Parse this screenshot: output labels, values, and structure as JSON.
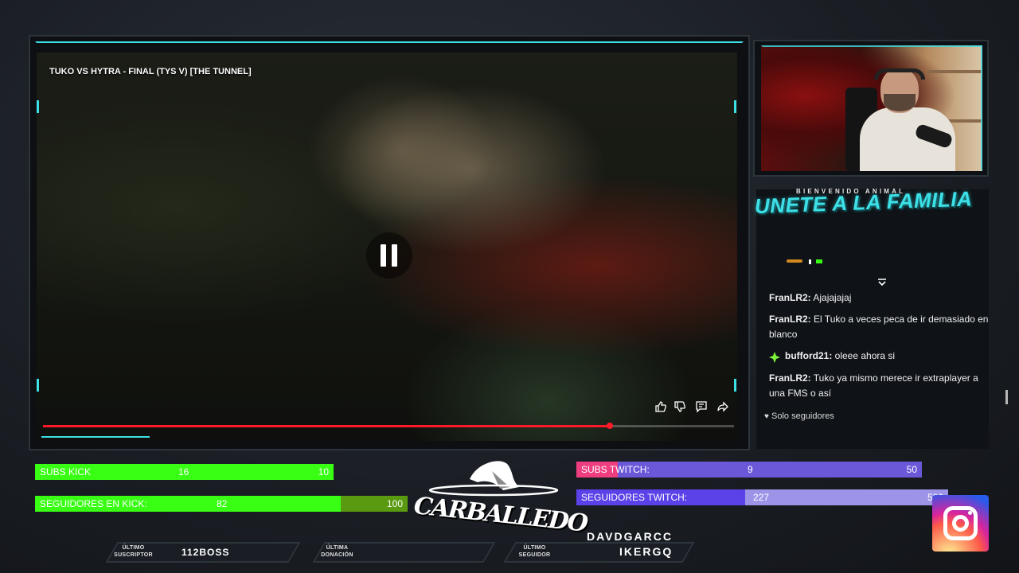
{
  "video": {
    "title": "TUKO VS HYTRA - FINAL (TYS V) [THE TUNNEL]",
    "progress_percent": 82,
    "icons": [
      "thumbs-up-icon",
      "thumbs-down-icon",
      "comment-icon",
      "share-icon"
    ]
  },
  "chat": {
    "welcome": "BIENVENIDO ANIMAL",
    "banner": "UNETE A LA FAMILIA",
    "messages": [
      {
        "user": "FranLR2:",
        "text": "Ajajajajaj"
      },
      {
        "user": "FranLR2:",
        "text": "El Tuko a veces peca de ir demasiado en blanco"
      },
      {
        "user": "bufford21:",
        "text": "oleee ahora si",
        "badge": "green-diamond"
      },
      {
        "user": "FranLR2:",
        "text": "Tuko ya mismo merece ir extraplayer a una FMS o así"
      }
    ],
    "followers_only": "Solo seguidores"
  },
  "goals": {
    "subs_kick": {
      "label": "SUBS KICK",
      "current": "16",
      "target": "10",
      "color": "#39ff14"
    },
    "followers_kick": {
      "label": "SEGUIDORES EN KICK:",
      "current": "82",
      "target": "100",
      "color": "#39ff14",
      "rest_color": "#5a9a10"
    },
    "subs_twitch": {
      "label": "SUBS TWITCH:",
      "current": "9",
      "target": "50",
      "color": "#ee3d80",
      "rest_color": "#6b58d8"
    },
    "followers_twitch": {
      "label": "SEGUIDORES TWITCH:",
      "current": "227",
      "target": "500",
      "color": "#5a42e8",
      "rest_color": "#9d94e8"
    }
  },
  "logo": {
    "text": "CARBALLEDO"
  },
  "recent": {
    "subscriber_label_1": "ÚLTIMO",
    "subscriber_label_2": "SUSCRIPTOR",
    "subscriber_value": "112BOSS",
    "donation_label_1": "ÚLTIMA",
    "donation_label_2": "DONACIÓN",
    "donation_value": "",
    "follower_label_1": "ÚLTIMO",
    "follower_label_2": "SEGUIDOR",
    "followers": [
      "DAVDGARCC",
      "IKERGQ"
    ]
  },
  "colors": {
    "accent": "#3ce0e6",
    "progress": "#ff1a2a"
  }
}
